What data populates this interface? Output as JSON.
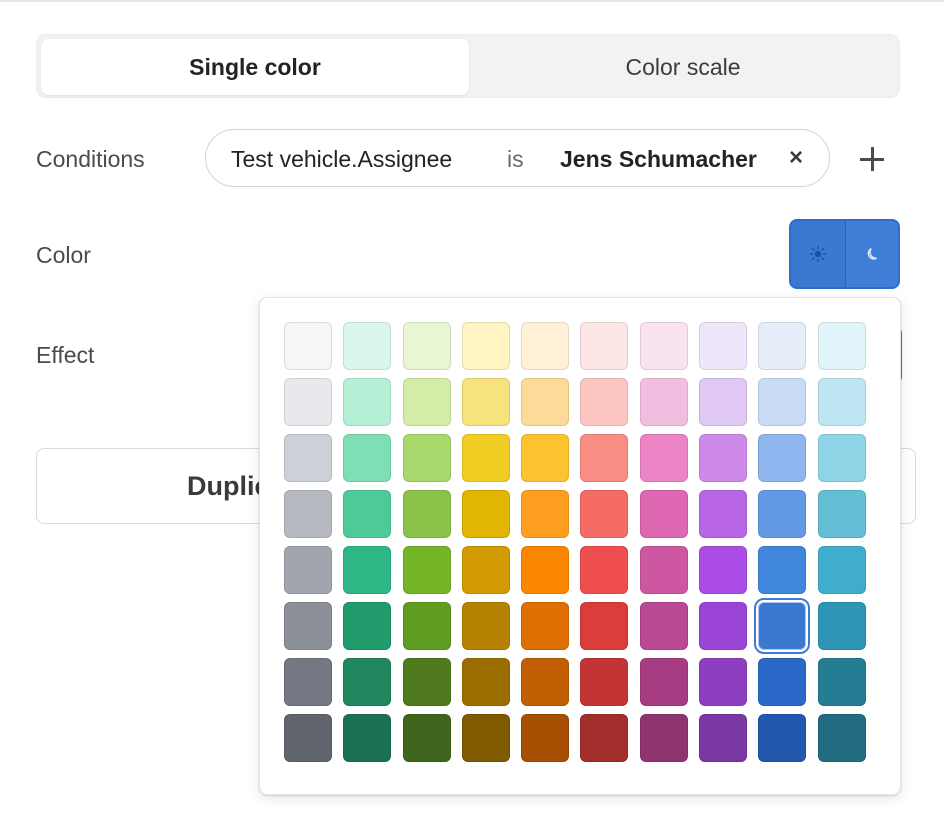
{
  "tabs": [
    {
      "label": "Single color",
      "active": true
    },
    {
      "label": "Color scale",
      "active": false
    }
  ],
  "conditions": {
    "label": "Conditions",
    "field": "Test vehicle.Assignee",
    "operator": "is",
    "value": "Jens Schumacher",
    "remove_icon": "×",
    "add_icon": "plus-icon"
  },
  "color": {
    "label": "Color",
    "theme_light_icon": "☀",
    "theme_dark_icon": "☾",
    "accent": "#3f7fd7"
  },
  "effect": {
    "label": "Effect"
  },
  "duplicate": {
    "label": "Duplic"
  },
  "palette": {
    "selected": "#3a78d2",
    "rows": [
      [
        "#f5f6f8",
        "#d9f7ea",
        "#e8f6d3",
        "#fff4c2",
        "#fff0d6",
        "#fde6e6",
        "#f8e3ef",
        "#efe6f9",
        "#e6eefa",
        "#e0f4f9"
      ],
      [
        "#e8e9ec",
        "#b4f0d6",
        "#d4eda6",
        "#f8e27c",
        "#fdda97",
        "#fbc6c1",
        "#f2bee0",
        "#dfc9f4",
        "#c8dcf6",
        "#bee6f2"
      ],
      [
        "#ccd1d8",
        "#7edfb7",
        "#a9d96c",
        "#f0cd22",
        "#fdc22f",
        "#f88d84",
        "#ec84c5",
        "#cd8ae9",
        "#8fb6ee",
        "#8fd3e6"
      ],
      [
        "#b6b9c0",
        "#4ccb98",
        "#8bc34a",
        "#e2b503",
        "#fd9e20",
        "#f56b66",
        "#de67b1",
        "#b865e6",
        "#6499e6",
        "#63bfd6"
      ],
      [
        "#a1a5ad",
        "#2db784",
        "#75b528",
        "#d29a03",
        "#fb8700",
        "#ef4e4e",
        "#cd58a1",
        "#aa4ce5",
        "#4186dd",
        "#40adcc"
      ],
      [
        "#8b8f97",
        "#229c6d",
        "#5f9c1f",
        "#b78202",
        "#df6f03",
        "#db3c3c",
        "#b94895",
        "#9b45d7",
        "#3a78d2",
        "#2e96b4"
      ],
      [
        "#737882",
        "#21875e",
        "#4f7b1e",
        "#9c6e02",
        "#c15f02",
        "#c33434",
        "#a63c82",
        "#8e3fbf",
        "#2b69c8",
        "#247d95"
      ],
      [
        "#5f646d",
        "#1d7153",
        "#3f661c",
        "#7f5a01",
        "#a74f02",
        "#a42d2d",
        "#8e356f",
        "#7a38a2",
        "#2259ae",
        "#216c80"
      ]
    ]
  }
}
